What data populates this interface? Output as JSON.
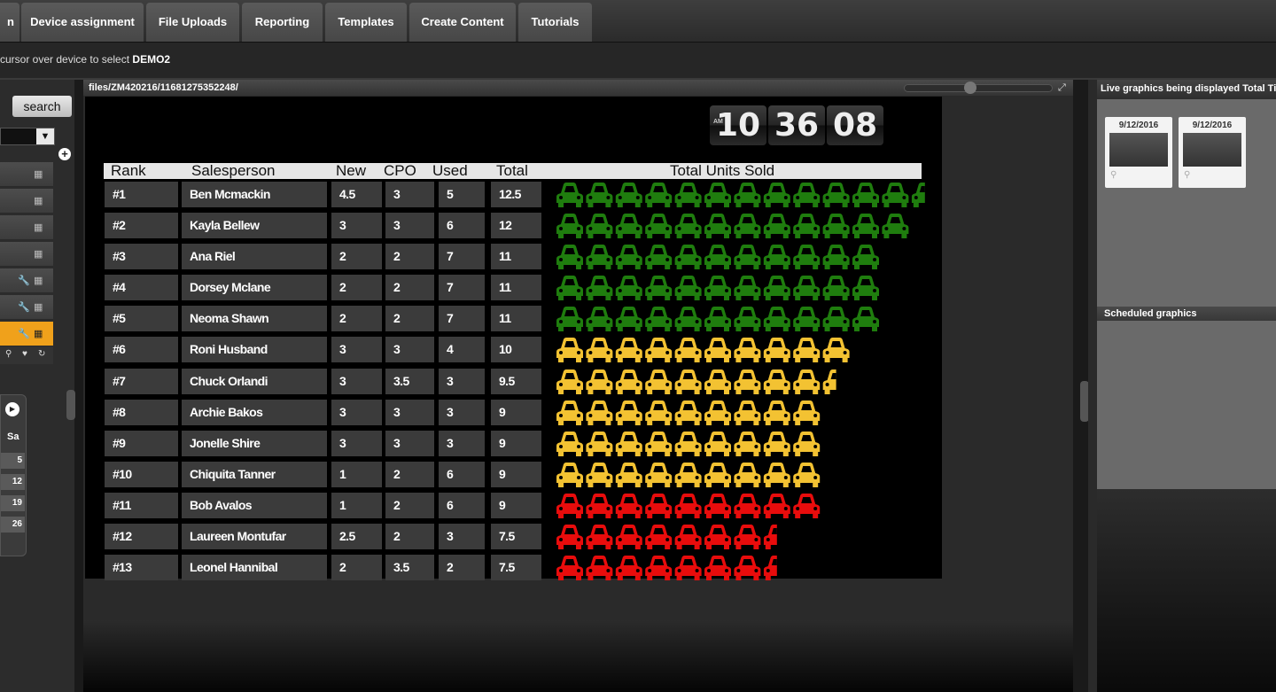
{
  "nav": {
    "tabs": [
      "n",
      "Device assignment",
      "File Uploads",
      "Reporting",
      "Templates",
      "Create Content",
      "Tutorials"
    ]
  },
  "crumb": {
    "text": "cursor over device to select",
    "device": "DEMO2"
  },
  "left": {
    "search_label": "search",
    "calendar": {
      "day_header": "Sa",
      "days": [
        "5",
        "12",
        "19",
        "26"
      ]
    }
  },
  "center": {
    "file_path": "files/ZM420216/11681275352248/"
  },
  "board": {
    "clock": {
      "h": "10",
      "m": "36",
      "s": "08",
      "ampm": "AM"
    },
    "headers": {
      "rank": "Rank",
      "salesperson": "Salesperson",
      "new": "New",
      "cpo": "CPO",
      "used": "Used",
      "total": "Total",
      "chart": "Total Units Sold"
    },
    "colors": {
      "green": "#1f7d0e",
      "yellow": "#f3c232",
      "red": "#e80c0c"
    },
    "rows": [
      {
        "rank": "#1",
        "name": "Ben Mcmackin",
        "new": "4.5",
        "cpo": "3",
        "used": "5",
        "total": "12.5",
        "units": 12.5,
        "color": "green"
      },
      {
        "rank": "#2",
        "name": "Kayla Bellew",
        "new": "3",
        "cpo": "3",
        "used": "6",
        "total": "12",
        "units": 12,
        "color": "green"
      },
      {
        "rank": "#3",
        "name": "Ana Riel",
        "new": "2",
        "cpo": "2",
        "used": "7",
        "total": "11",
        "units": 11,
        "color": "green"
      },
      {
        "rank": "#4",
        "name": "Dorsey Mclane",
        "new": "2",
        "cpo": "2",
        "used": "7",
        "total": "11",
        "units": 11,
        "color": "green"
      },
      {
        "rank": "#5",
        "name": "Neoma Shawn",
        "new": "2",
        "cpo": "2",
        "used": "7",
        "total": "11",
        "units": 11,
        "color": "green"
      },
      {
        "rank": "#6",
        "name": "Roni Husband",
        "new": "3",
        "cpo": "3",
        "used": "4",
        "total": "10",
        "units": 10,
        "color": "yellow"
      },
      {
        "rank": "#7",
        "name": "Chuck Orlandi",
        "new": "3",
        "cpo": "3.5",
        "used": "3",
        "total": "9.5",
        "units": 9.5,
        "color": "yellow"
      },
      {
        "rank": "#8",
        "name": "Archie Bakos",
        "new": "3",
        "cpo": "3",
        "used": "3",
        "total": "9",
        "units": 9,
        "color": "yellow"
      },
      {
        "rank": "#9",
        "name": "Jonelle Shire",
        "new": "3",
        "cpo": "3",
        "used": "3",
        "total": "9",
        "units": 9,
        "color": "yellow"
      },
      {
        "rank": "#10",
        "name": "Chiquita Tanner",
        "new": "1",
        "cpo": "2",
        "used": "6",
        "total": "9",
        "units": 9,
        "color": "yellow"
      },
      {
        "rank": "#11",
        "name": "Bob Avalos",
        "new": "1",
        "cpo": "2",
        "used": "6",
        "total": "9",
        "units": 9,
        "color": "red"
      },
      {
        "rank": "#12",
        "name": "Laureen Montufar",
        "new": "2.5",
        "cpo": "2",
        "used": "3",
        "total": "7.5",
        "units": 7.5,
        "color": "red"
      },
      {
        "rank": "#13",
        "name": "Leonel Hannibal",
        "new": "2",
        "cpo": "3.5",
        "used": "2",
        "total": "7.5",
        "units": 7.5,
        "color": "red"
      }
    ]
  },
  "right": {
    "title": "Live graphics being displayed Total Ti",
    "thumbs": [
      {
        "date": "9/12/2016"
      },
      {
        "date": "9/12/2016"
      }
    ],
    "scheduled_title": "Scheduled graphics"
  }
}
